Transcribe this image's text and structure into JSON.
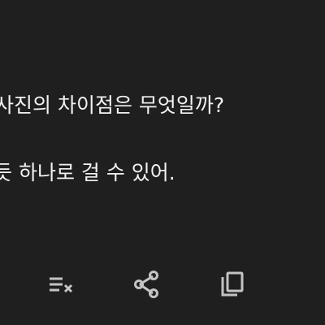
{
  "message": {
    "line1": "사진의 차이점은 무엇일까?",
    "line2": "듯 하나로 걸 수 있어."
  },
  "toolbar": {
    "buttons": [
      {
        "icon": "playlist-remove-icon"
      },
      {
        "icon": "share-icon"
      },
      {
        "icon": "copy-icon"
      }
    ]
  },
  "colors": {
    "background": "#1f1f1f",
    "text": "#f2f2f2",
    "icon": "#c4c4c4"
  }
}
